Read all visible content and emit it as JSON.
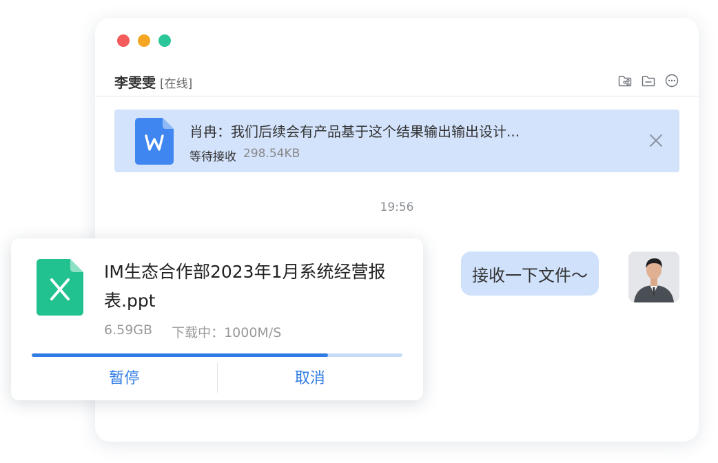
{
  "window": {
    "controls": [
      {
        "name": "close-dot",
        "color": "#f45c5c"
      },
      {
        "name": "minimize-dot",
        "color": "#f5a623"
      },
      {
        "name": "maximize-dot",
        "color": "#2bc79a"
      }
    ]
  },
  "header": {
    "contact_name": "李雯雯",
    "contact_status": "[在线]",
    "icons": [
      "folder-share-icon",
      "folder-icon",
      "more-icon"
    ]
  },
  "banner": {
    "icon": "word-file-icon",
    "title": "肖冉：我们后续会有产品基于这个结果输出输出设计...",
    "status": "等待接收",
    "size": "298.54KB",
    "close_icon": "close-icon"
  },
  "messages": {
    "timestamp": "19:56",
    "bubble_text": "接收一下文件～"
  },
  "transfer": {
    "icon": "excel-file-icon",
    "file_name": "IM生态合作部2023年1月系统经营报表.ppt",
    "size": "6.59GB",
    "status": "下载中：1000M/S",
    "progress": 0.8,
    "pause_label": "暂停",
    "cancel_label": "取消"
  },
  "colors": {
    "accent": "#2f7be5",
    "banner_bg": "#d3e3fb",
    "bubble_bg": "#cfe1fb",
    "word_blue": "#3f86f0",
    "excel_green": "#22c290"
  }
}
